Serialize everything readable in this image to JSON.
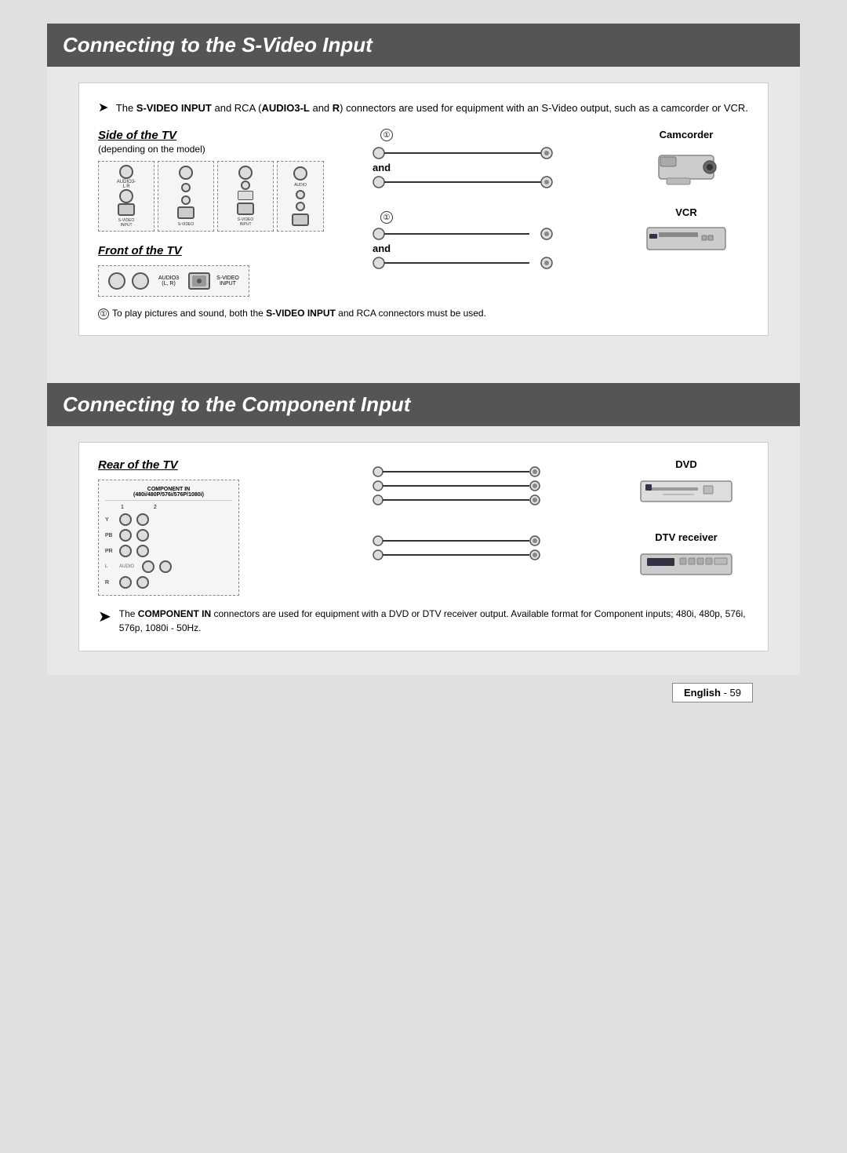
{
  "svideo_section": {
    "header": "Connecting to the S-Video Input",
    "intro": {
      "arrow": "➤",
      "text_before": "The ",
      "bold1": "S-VIDEO INPUT",
      "text_mid1": " and RCA (",
      "bold2": "AUDIO3-L",
      "text_mid2": " and ",
      "bold3": "R",
      "text_after": ") connectors are used for equipment with an S-Video output, such as a camcorder or VCR."
    },
    "side_label": "Side of the TV",
    "side_sub": "(depending on the model)",
    "front_label": "Front of the TV",
    "and_label": "and",
    "circle1": "①",
    "camcorder_label": "Camcorder",
    "vcr_label": "VCR",
    "footnote_num": "①",
    "footnote_text": " To play pictures and sound, both the ",
    "footnote_bold": "S-VIDEO INPUT",
    "footnote_end": " and RCA connectors must be used."
  },
  "component_section": {
    "header": "Connecting to the Component Input",
    "rear_label": "Rear of the TV",
    "panel_title": "COMPONENT IN\n(480i/480P/576i/576P/1080i)",
    "row_labels": [
      "Y",
      "PB",
      "PR",
      "L",
      "R"
    ],
    "dvd_label": "DVD",
    "dtv_label": "DTV receiver",
    "arrow": "➤",
    "footnote_bold": "COMPONENT IN",
    "footnote_text": " connectors are used for equipment with a DVD or DTV receiver output. Available format for Component inputs; 480i, 480p, 576i, 576p, 1080i - 50Hz."
  },
  "footer": {
    "language": "English",
    "page_num": "- 59"
  }
}
